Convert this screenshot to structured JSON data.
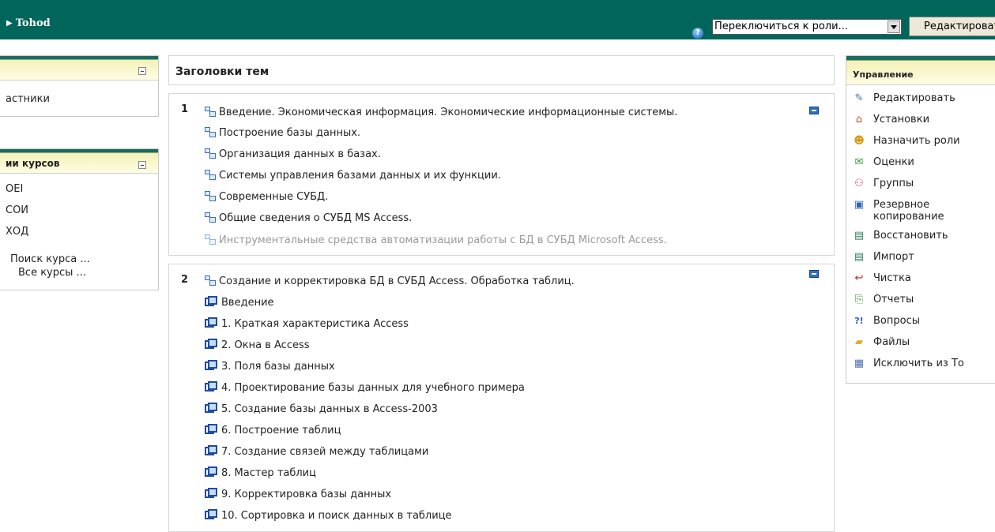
{
  "header": {
    "breadcrumb": "Tohod",
    "role_select_value": "Переключиться к роли...",
    "edit_button": "Редактировать"
  },
  "left_blocks": [
    {
      "title": "",
      "items": [
        "астники"
      ]
    },
    {
      "title": "ии курсов",
      "items": [
        "OEI",
        "СОИ",
        "ХОД"
      ],
      "links": [
        "Поиск курса ...",
        "Все курсы ..."
      ]
    }
  ],
  "topics": {
    "heading": "Заголовки тем",
    "sections": [
      {
        "number": "1",
        "items": [
          {
            "text": "Введение. Экономическая информация. Экономические информационные системы.",
            "icon": "resource-icon",
            "dimmed": false
          },
          {
            "text": "Построение базы данных.",
            "icon": "resource-icon",
            "dimmed": false
          },
          {
            "text": "Организация данных в базах.",
            "icon": "resource-icon",
            "dimmed": false
          },
          {
            "text": "Системы управления базами данных и их функции.",
            "icon": "resource-icon",
            "dimmed": false
          },
          {
            "text": "Современные СУБД.",
            "icon": "resource-icon",
            "dimmed": false
          },
          {
            "text": "Общие сведения о СУБД MS Access.",
            "icon": "resource-icon",
            "dimmed": false
          },
          {
            "text": "Инструментальные средства автоматизации работы с БД в СУБД Microsoft Access.",
            "icon": "resource-icon",
            "dimmed": true
          }
        ]
      },
      {
        "number": "2",
        "items": [
          {
            "text": "Создание и корректировка БД в СУБД Access. Обработка таблиц.",
            "icon": "resource-icon"
          },
          {
            "text": "Введение",
            "icon": "page-icon"
          },
          {
            "text": "1. Краткая характеристика Access",
            "icon": "page-icon"
          },
          {
            "text": "2. Окна в Access",
            "icon": "page-icon"
          },
          {
            "text": "3. Поля базы данных",
            "icon": "page-icon"
          },
          {
            "text": "4. Проектирование базы данных для учебного примера",
            "icon": "page-icon"
          },
          {
            "text": "5. Создание базы данных в Access-2003",
            "icon": "page-icon"
          },
          {
            "text": "6. Построение таблиц",
            "icon": "page-icon"
          },
          {
            "text": "7. Создание связей между таблицами",
            "icon": "page-icon"
          },
          {
            "text": "8. Мастер таблиц",
            "icon": "page-icon"
          },
          {
            "text": "9. Корректировка базы данных",
            "icon": "page-icon"
          },
          {
            "text": "10. Сортировка и поиск данных в таблице",
            "icon": "page-icon"
          }
        ]
      }
    ]
  },
  "admin": {
    "title": "Управление",
    "items": [
      {
        "label": "Редактировать",
        "icon": "edit-icon"
      },
      {
        "label": "Установки",
        "icon": "settings-icon"
      },
      {
        "label": "Назначить роли",
        "icon": "roles-icon"
      },
      {
        "label": "Оценки",
        "icon": "grades-icon"
      },
      {
        "label": "Группы",
        "icon": "groups-icon"
      },
      {
        "label": "Резервное копирование",
        "icon": "backup-icon"
      },
      {
        "label": "Восстановить",
        "icon": "restore-icon"
      },
      {
        "label": "Импорт",
        "icon": "import-icon"
      },
      {
        "label": "Чистка",
        "icon": "reset-icon"
      },
      {
        "label": "Отчеты",
        "icon": "reports-icon"
      },
      {
        "label": "Вопросы",
        "icon": "questions-icon"
      },
      {
        "label": "Файлы",
        "icon": "files-icon"
      },
      {
        "label": "Исключить из То",
        "icon": "unenrol-icon"
      }
    ]
  }
}
